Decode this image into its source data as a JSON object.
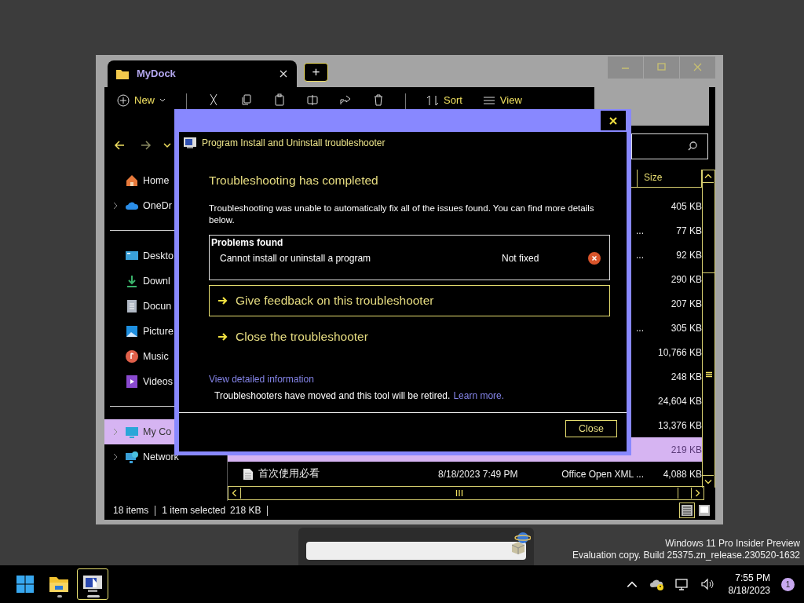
{
  "explorer": {
    "tab": {
      "title": "MyDock"
    },
    "new_tab_button": "+",
    "toolbar": {
      "new_label": "New",
      "sort_label": "Sort",
      "view_label": "View"
    },
    "sidebar_groups": [
      [
        {
          "label": "Home",
          "kind": "home",
          "expandable": false,
          "selected": false
        },
        {
          "label": "OneDr",
          "kind": "cloud",
          "expandable": true,
          "selected": false
        }
      ],
      [
        {
          "label": "Deskto",
          "kind": "desktop",
          "expandable": false,
          "selected": false
        },
        {
          "label": "Downl",
          "kind": "download",
          "expandable": false,
          "selected": false
        },
        {
          "label": "Docun",
          "kind": "document",
          "expandable": false,
          "selected": false
        },
        {
          "label": "Picture",
          "kind": "pictures",
          "expandable": false,
          "selected": false
        },
        {
          "label": "Music",
          "kind": "music",
          "expandable": false,
          "selected": false
        },
        {
          "label": "Videos",
          "kind": "videos",
          "expandable": false,
          "selected": false
        }
      ],
      [
        {
          "label": "My Co",
          "kind": "computer",
          "expandable": true,
          "selected": true
        },
        {
          "label": "Network",
          "kind": "network",
          "expandable": true,
          "selected": false
        }
      ]
    ],
    "size_column": "Size",
    "rows": [
      {
        "size": "405 KB",
        "selected": false
      },
      {
        "type": "...",
        "size": "77 KB",
        "selected": false
      },
      {
        "type": "...",
        "size": "92 KB",
        "selected": false
      },
      {
        "size": "290 KB",
        "selected": false
      },
      {
        "size": "207 KB",
        "selected": false
      },
      {
        "type": "...",
        "size": "305 KB",
        "selected": false
      },
      {
        "size": "10,766 KB",
        "selected": false
      },
      {
        "size": "248 KB",
        "selected": false
      },
      {
        "size": "24,604 KB",
        "selected": false
      },
      {
        "size": "13,376 KB",
        "selected": false
      },
      {
        "size": "219 KB",
        "selected": true
      },
      {
        "name": "首次使用必看",
        "date": "8/18/2023 7:49 PM",
        "type": "Office Open XML ...",
        "size": "4,088 KB",
        "selected": false
      }
    ],
    "status_bar": {
      "count": "18 items",
      "selection": "1 item selected",
      "selection_size": "218 KB"
    },
    "view_buttons": [
      {
        "kind": "details",
        "selected": true
      },
      {
        "kind": "tiles",
        "selected": false
      }
    ]
  },
  "dialog": {
    "title": "Program Install and Uninstall troubleshooter",
    "heading": "Troubleshooting has completed",
    "message": "Troubleshooting was unable to automatically fix all of the issues found. You can find more details below.",
    "problems": {
      "title": "Problems found",
      "items": [
        {
          "name": "Cannot install or uninstall a program",
          "status": "Not fixed",
          "fixed": false
        }
      ]
    },
    "actions": [
      {
        "label": "Give feedback on this troubleshooter",
        "selected": true
      },
      {
        "label": "Close the troubleshooter",
        "selected": false
      }
    ],
    "details_link": "View detailed information",
    "notice": "Troubleshooters have moved and this tool will be retired.",
    "notice_link": "Learn more.",
    "close_button": "Close"
  },
  "os_notice": [
    "Windows 11 Pro Insider Preview",
    "Evaluation copy. Build 25375.zn_release.230520-1632"
  ],
  "taskbar": {
    "apps": [
      {
        "kind": "start",
        "running": false,
        "selected": false
      },
      {
        "kind": "folder",
        "running": true,
        "selected": false
      },
      {
        "kind": "app",
        "running": true,
        "selected": true
      }
    ],
    "time": "7:55 PM",
    "date": "8/18/2023",
    "notification_count": "1"
  }
}
